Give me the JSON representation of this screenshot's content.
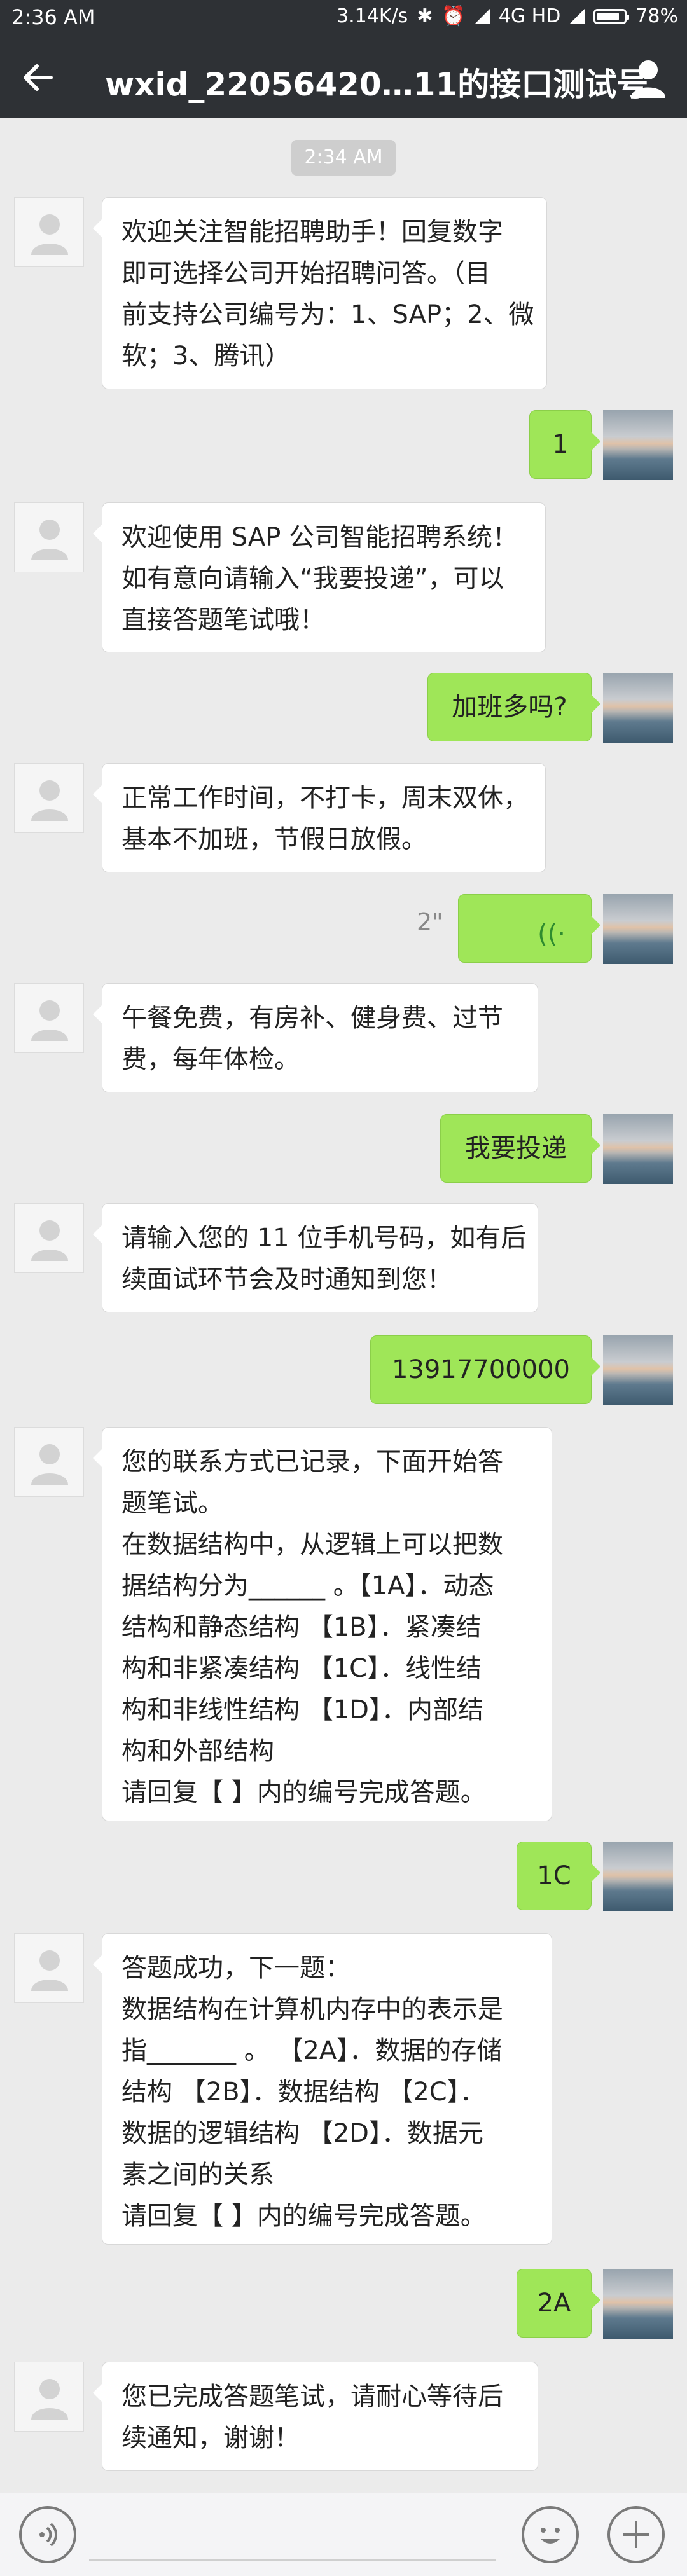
{
  "status_bar": {
    "time": "2:36 AM",
    "speed": "3.14K/s",
    "network": "4G HD",
    "battery": "78%"
  },
  "header": {
    "back_icon": "arrow-left-icon",
    "title": "wxid_22056420…11的接口测试号",
    "profile_icon": "person-icon"
  },
  "timestamp": "2:34 AM",
  "messages": [
    {
      "side": "left",
      "lines": [
        "欢迎关注智能招聘助手！回复数字",
        "即可选择公司开始招聘问答。（目",
        "前支持公司编号为：1、SAP；2、微",
        "软；3、腾讯）"
      ]
    },
    {
      "side": "right",
      "lines": [
        "1"
      ]
    },
    {
      "side": "left",
      "lines": [
        "欢迎使用 SAP 公司智能招聘系统！",
        "如有意向请输入“我要投递”，可以",
        "直接答题笔试哦！"
      ]
    },
    {
      "side": "right",
      "lines": [
        "加班多吗?"
      ]
    },
    {
      "side": "left",
      "lines": [
        "正常工作时间，不打卡，周末双休，",
        "基本不加班，节假日放假。"
      ]
    },
    {
      "side": "right",
      "type": "voice",
      "duration": "2\""
    },
    {
      "side": "left",
      "lines": [
        "午餐免费，有房补、健身费、过节",
        "费，每年体检。"
      ]
    },
    {
      "side": "right",
      "lines": [
        "我要投递"
      ]
    },
    {
      "side": "left",
      "lines": [
        "请输入您的 11 位手机号码，如有后",
        "续面试环节会及时通知到您！"
      ]
    },
    {
      "side": "right",
      "lines": [
        "13917700000"
      ]
    },
    {
      "side": "left",
      "lines": [
        "您的联系方式已记录，下面开始答",
        "题笔试。",
        "在数据结构中，从逻辑上可以把数",
        "据结构分为______ 。【1A】．动态",
        "结构和静态结构  【1B】．紧凑结",
        "构和非紧凑结构  【1C】．线性结",
        "构和非线性结构  【1D】．内部结",
        "构和外部结构",
        "请回复【 】内的编号完成答题。"
      ]
    },
    {
      "side": "right",
      "lines": [
        "1C"
      ]
    },
    {
      "side": "left",
      "lines": [
        "答题成功，下一题：",
        "数据结构在计算机内存中的表示是",
        "指_______ 。 【2A】．数据的存储",
        "结构  【2B】．数据结构  【2C】．",
        "数据的逻辑结构  【2D】．数据元",
        "素之间的关系",
        "请回复【 】内的编号完成答题。"
      ]
    },
    {
      "side": "right",
      "lines": [
        "2A"
      ]
    },
    {
      "side": "left",
      "lines": [
        "您已完成答题笔试，请耐心等待后",
        "续通知，谢谢！"
      ]
    }
  ],
  "bottom_bar": {
    "voice_icon": "voice-toggle-icon",
    "emoji_icon": "emoji-icon",
    "plus_icon": "plus-icon"
  },
  "colors": {
    "header_bg": "#2e3135",
    "chat_bg": "#ebebeb",
    "sent_bubble": "#9fe658",
    "received_bubble": "#ffffff"
  }
}
